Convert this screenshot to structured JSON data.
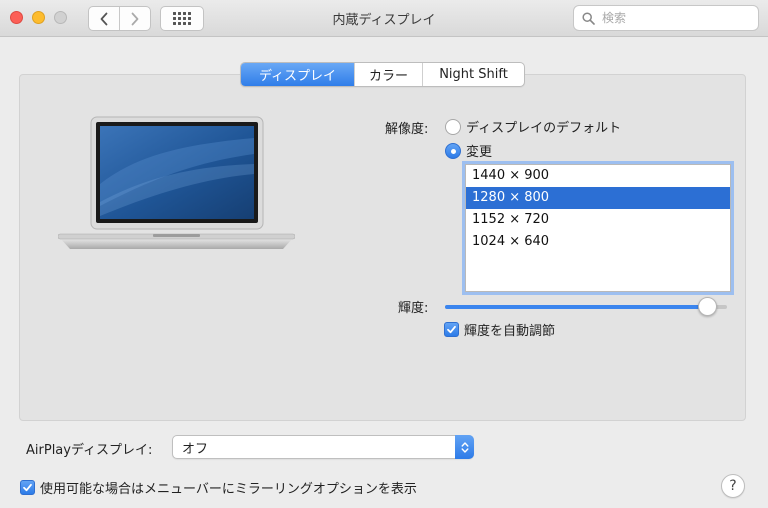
{
  "window": {
    "title": "内蔵ディスプレイ"
  },
  "search": {
    "placeholder": "検索"
  },
  "tabs": [
    {
      "label": "ディスプレイ",
      "active": true
    },
    {
      "label": "カラー",
      "active": false
    },
    {
      "label": "Night Shift",
      "active": false
    }
  ],
  "resolution": {
    "label": "解像度:",
    "options": [
      {
        "label": "ディスプレイのデフォルト",
        "selected": false
      },
      {
        "label": "変更",
        "selected": true
      }
    ],
    "list": [
      "1440 × 900",
      "1280 × 800",
      "1152 × 720",
      "1024 × 640"
    ],
    "selected_item": "1280 × 800"
  },
  "brightness": {
    "label": "輝度:",
    "level_percent": 93,
    "auto_label": "輝度を自動調節",
    "auto_checked": true
  },
  "airplay": {
    "label": "AirPlayディスプレイ:",
    "value": "オフ"
  },
  "mirroring": {
    "label": "使用可能な場合はメニューバーにミラーリングオプションを表示",
    "checked": true
  },
  "help": {
    "label": "?"
  },
  "colors": {
    "accent": "#2c6fd4",
    "close": "#fc5f57",
    "minimize": "#fdbc2e"
  }
}
